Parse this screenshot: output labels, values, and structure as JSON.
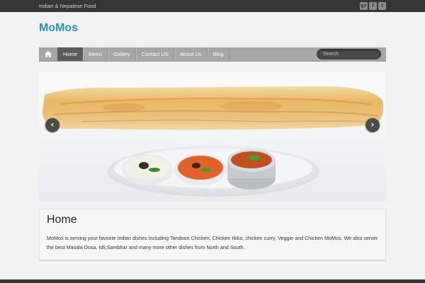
{
  "header": {
    "tagline": "Indian & Nepalese Food",
    "social_icons": [
      {
        "name": "google-plus-icon",
        "glyph": "g+"
      },
      {
        "name": "facebook-icon",
        "glyph": "f"
      },
      {
        "name": "twitter-icon",
        "glyph": "t"
      }
    ],
    "logo": "MoMos"
  },
  "nav": {
    "home_icon": "home-icon",
    "items": [
      {
        "label": "Home",
        "active": true
      },
      {
        "label": "Menu",
        "active": false
      },
      {
        "label": "Gallery",
        "active": false
      },
      {
        "label": "Contact US",
        "active": false
      },
      {
        "label": "About Us",
        "active": false
      },
      {
        "label": "Blog",
        "active": false
      }
    ],
    "search_placeholder": "Search"
  },
  "slider": {
    "prev_icon": "chevron-left-icon",
    "next_icon": "chevron-right-icon",
    "prev_glyph": "‹",
    "next_glyph": "›"
  },
  "content": {
    "title": "Home",
    "body": "MoMos is serving your favorite Indian dishes including Tandoori Chicken, Chicken tikka, chicken curry, Veggie and Chicken MoMos. We also server the best Masala Dosa, Idli,Sambhar and many more other dishes from North and South."
  },
  "colors": {
    "brand": "#2b8ec8",
    "topbar": "#363636",
    "nav": "#a6a6a6",
    "nav_active": "#5b5b5b"
  }
}
